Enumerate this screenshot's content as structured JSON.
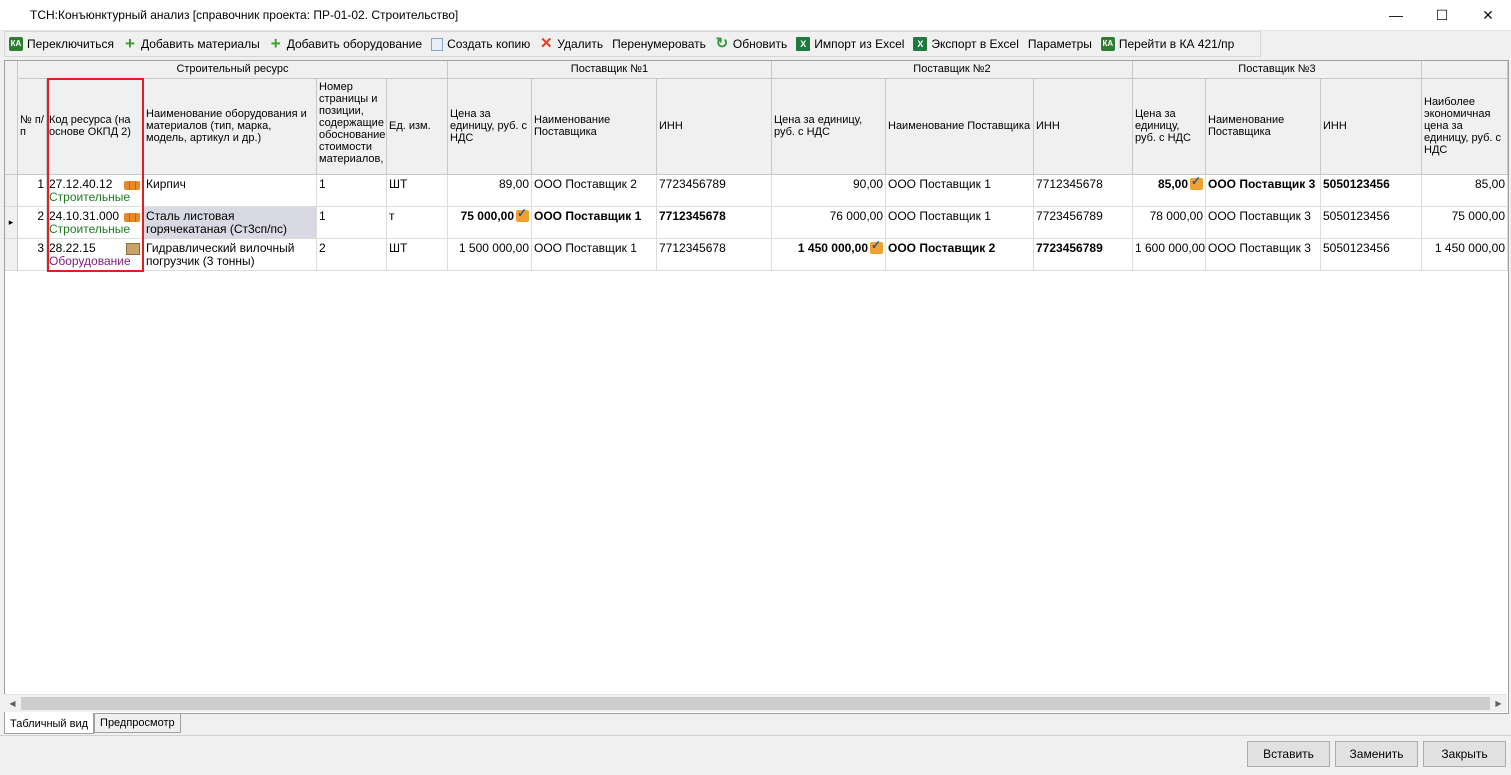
{
  "window": {
    "title": "ТСН:Конъюнктурный анализ [справочник проекта: ПР-01-02. Строительство]",
    "minimize": "—",
    "maximize": "☐",
    "close": "✕"
  },
  "toolbar": {
    "switch": "Переключиться",
    "add_materials": "Добавить материалы",
    "add_equipment": "Добавить оборудование",
    "create_copy": "Создать копию",
    "delete": "Удалить",
    "renumber": "Перенумеровать",
    "refresh": "Обновить",
    "import_excel": "Импорт из Excel",
    "export_excel": "Экспорт в Excel",
    "parameters": "Параметры",
    "goto_ka": "Перейти в КА 421/пр",
    "icons": {
      "ka": "КА",
      "plus": "+",
      "delete": "✕",
      "refresh": "↻",
      "excel": "X"
    }
  },
  "grid": {
    "groups": {
      "resource": "Строительный ресурс",
      "supplier1": "Поставщик №1",
      "supplier2": "Поставщик №2",
      "supplier3": "Поставщик №3"
    },
    "columns": {
      "num": "№ п/п",
      "code": "Код ресурса (на основе ОКПД 2)",
      "name": "Наименование оборудования и материалов (тип, марка, модель, артикул и др.)",
      "page": "Номер страницы и позиции, содержащие обоснование стоимости материалов,",
      "unit": "Ед. изм.",
      "s1_price": "Цена за единицу, руб. с НДС",
      "s1_name": "Наименование Поставщика",
      "s1_inn": "ИНН",
      "s2_price": "Цена за единицу, руб. с НДС",
      "s2_name": "Наименование Поставщика",
      "s2_inn": "ИНН",
      "s3_price": "Цена за единицу, руб. с НДС",
      "s3_name": "Наименование Поставщика",
      "s3_inn": "ИНН",
      "best": "Наиболее экономичная цена за единицу, руб. с НДС"
    },
    "rows": [
      {
        "num": "1",
        "code": "27.12.40.12",
        "category": "Строительные",
        "name": "Кирпич",
        "page": "1",
        "unit": "ШТ",
        "s1_price": "89,00",
        "s1_name": "ООО Поставщик 2",
        "s1_inn": "7723456789",
        "s2_price": "90,00",
        "s2_name": "ООО Поставщик 1",
        "s2_inn": "7712345678",
        "s3_price": "85,00",
        "s3_name": "ООО Поставщик 3",
        "s3_inn": "5050123456",
        "best": "85,00"
      },
      {
        "num": "2",
        "code": "24.10.31.000",
        "category": "Строительные",
        "name": "Сталь листовая горячекатаная (Ст3сп/пс)",
        "page": "1",
        "unit": "т",
        "s1_price": "75 000,00",
        "s1_name": "ООО Поставщик 1",
        "s1_inn": "7712345678",
        "s2_price": "76 000,00",
        "s2_name": "ООО Поставщик 1",
        "s2_inn": "7723456789",
        "s3_price": "78 000,00",
        "s3_name": "ООО Поставщик 3",
        "s3_inn": "5050123456",
        "best": "75 000,00"
      },
      {
        "num": "3",
        "code": "28.22.15",
        "category": "Оборудование",
        "name": "Гидравлический вилочный погрузчик (3 тонны)",
        "page": "2",
        "unit": "ШТ",
        "s1_price": "1 500 000,00",
        "s1_name": "ООО Поставщик 1",
        "s1_inn": "7712345678",
        "s2_price": "1 450 000,00",
        "s2_name": "ООО Поставщик 2",
        "s2_inn": "7723456789",
        "s3_price": "1 600 000,00",
        "s3_name": "ООО Поставщик 3",
        "s3_inn": "5050123456",
        "best": "1 450 000,00"
      }
    ],
    "row_indicator": "▸"
  },
  "scroll": {
    "left": "◀",
    "right": "▶"
  },
  "tabs": {
    "table_view": "Табличный вид",
    "preview": "Предпросмотр"
  },
  "buttons": {
    "insert": "Вставить",
    "replace": "Заменить",
    "close": "Закрыть"
  }
}
